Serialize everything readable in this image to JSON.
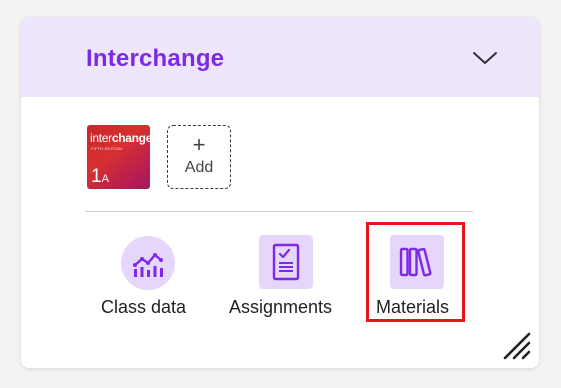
{
  "card": {
    "title": "Interchange"
  },
  "book": {
    "brand_prefix": "inter",
    "brand_suffix": "change",
    "tiny_text": "FIFTH EDITION",
    "level": "1",
    "level_sub": "A"
  },
  "add": {
    "plus": "+",
    "label": "Add"
  },
  "actions": {
    "class_data": "Class data",
    "assignments": "Assignments",
    "materials": "Materials"
  },
  "colors": {
    "accent": "#7c2ae8",
    "header_bg": "#eee6fd",
    "icon_bg": "#e6d6fc",
    "highlight": "#e8121a"
  }
}
